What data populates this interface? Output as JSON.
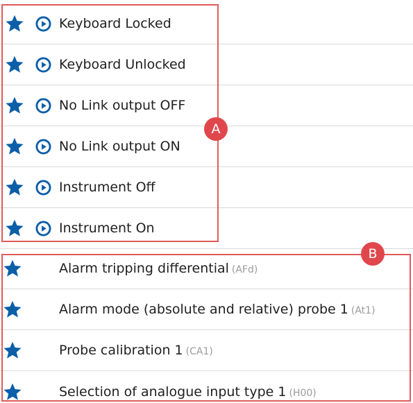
{
  "colors": {
    "star": "#0b5ea8",
    "play": "#0b5ea8",
    "highlight_box": "#e05a5a",
    "badge": "#e0474c",
    "row_divider": "#d9d9d9",
    "code_text": "#9a9a9a"
  },
  "commands": {
    "items": [
      {
        "label": "Keyboard Locked",
        "favorite_icon": "star-icon",
        "action_icon": "play-circle-icon"
      },
      {
        "label": "Keyboard Unlocked",
        "favorite_icon": "star-icon",
        "action_icon": "play-circle-icon"
      },
      {
        "label": "No Link output OFF",
        "favorite_icon": "star-icon",
        "action_icon": "play-circle-icon"
      },
      {
        "label": "No Link output ON",
        "favorite_icon": "star-icon",
        "action_icon": "play-circle-icon"
      },
      {
        "label": "Instrument Off",
        "favorite_icon": "star-icon",
        "action_icon": "play-circle-icon"
      },
      {
        "label": "Instrument On",
        "favorite_icon": "star-icon",
        "action_icon": "play-circle-icon"
      }
    ],
    "badge": "A"
  },
  "parameters": {
    "items": [
      {
        "label": "Alarm tripping differential",
        "code": "(AFd)",
        "favorite_icon": "star-icon"
      },
      {
        "label": "Alarm mode (absolute and relative) probe 1",
        "code": "(At1)",
        "favorite_icon": "star-icon"
      },
      {
        "label": "Probe calibration 1",
        "code": "(CA1)",
        "favorite_icon": "star-icon"
      },
      {
        "label": "Selection of analogue input type 1",
        "code": "(H00)",
        "favorite_icon": "star-icon"
      }
    ],
    "badge": "B"
  }
}
